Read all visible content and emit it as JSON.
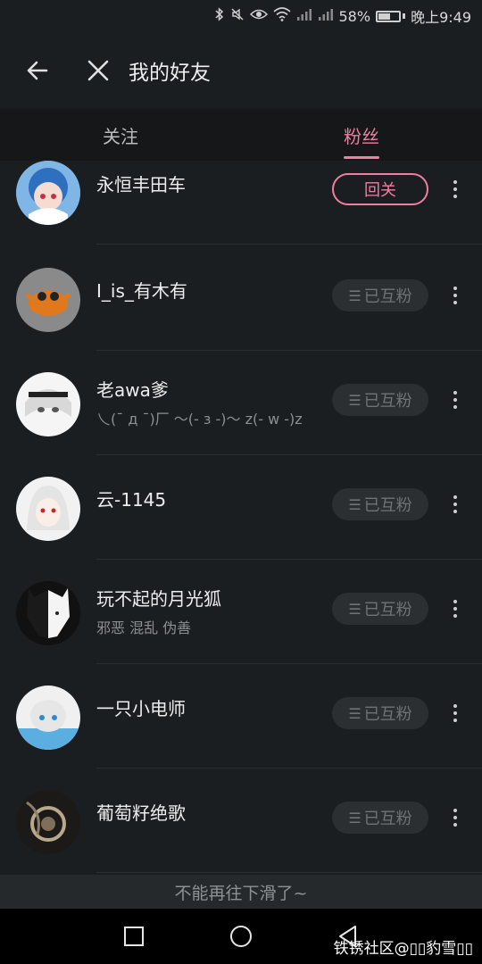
{
  "status_bar": {
    "battery": "58%",
    "time": "晚上9:49",
    "battery_level": 0.58,
    "icons": [
      "bluetooth-icon",
      "mute-icon",
      "eye-icon",
      "wifi-icon",
      "signal-icon",
      "signal-icon",
      "battery-icon"
    ]
  },
  "header": {
    "title": "我的好友",
    "back_icon": "back-arrow-icon",
    "close_icon": "close-icon"
  },
  "tabs": [
    {
      "label": "关注",
      "active": false
    },
    {
      "label": "粉丝",
      "active": true
    }
  ],
  "users": [
    {
      "name": "永恒丰田车",
      "signature": "",
      "action": "回关",
      "action_type": "follow-back"
    },
    {
      "name": "I_is_有木有",
      "signature": "",
      "action": "已互粉",
      "action_type": "mutual"
    },
    {
      "name": "老awa爹",
      "signature": "乀(ˉ д ˉ)厂 ～(- з -)～ z(- w -)z",
      "action": "已互粉",
      "action_type": "mutual"
    },
    {
      "name": "云-1145",
      "signature": "",
      "action": "已互粉",
      "action_type": "mutual"
    },
    {
      "name": "玩不起的月光狐",
      "signature": "邪恶 混乱 伪善",
      "action": "已互粉",
      "action_type": "mutual"
    },
    {
      "name": "一只小电师",
      "signature": "",
      "action": "已互粉",
      "action_type": "mutual"
    },
    {
      "name": "葡萄籽绝歌",
      "signature": "",
      "action": "已互粉",
      "action_type": "mutual"
    }
  ],
  "list_end_text": "不能再往下滑了~",
  "navbar": {
    "icons": [
      "square-recents-icon",
      "circle-home-icon",
      "triangle-back-icon"
    ],
    "watermark": "铁锈社区@▯▯豹雪▯▯"
  },
  "colors": {
    "accent": "#ef7fa0",
    "background": "#1b1e20",
    "tab_bar": "#151718",
    "pill_mutual": "#2c2f32"
  }
}
